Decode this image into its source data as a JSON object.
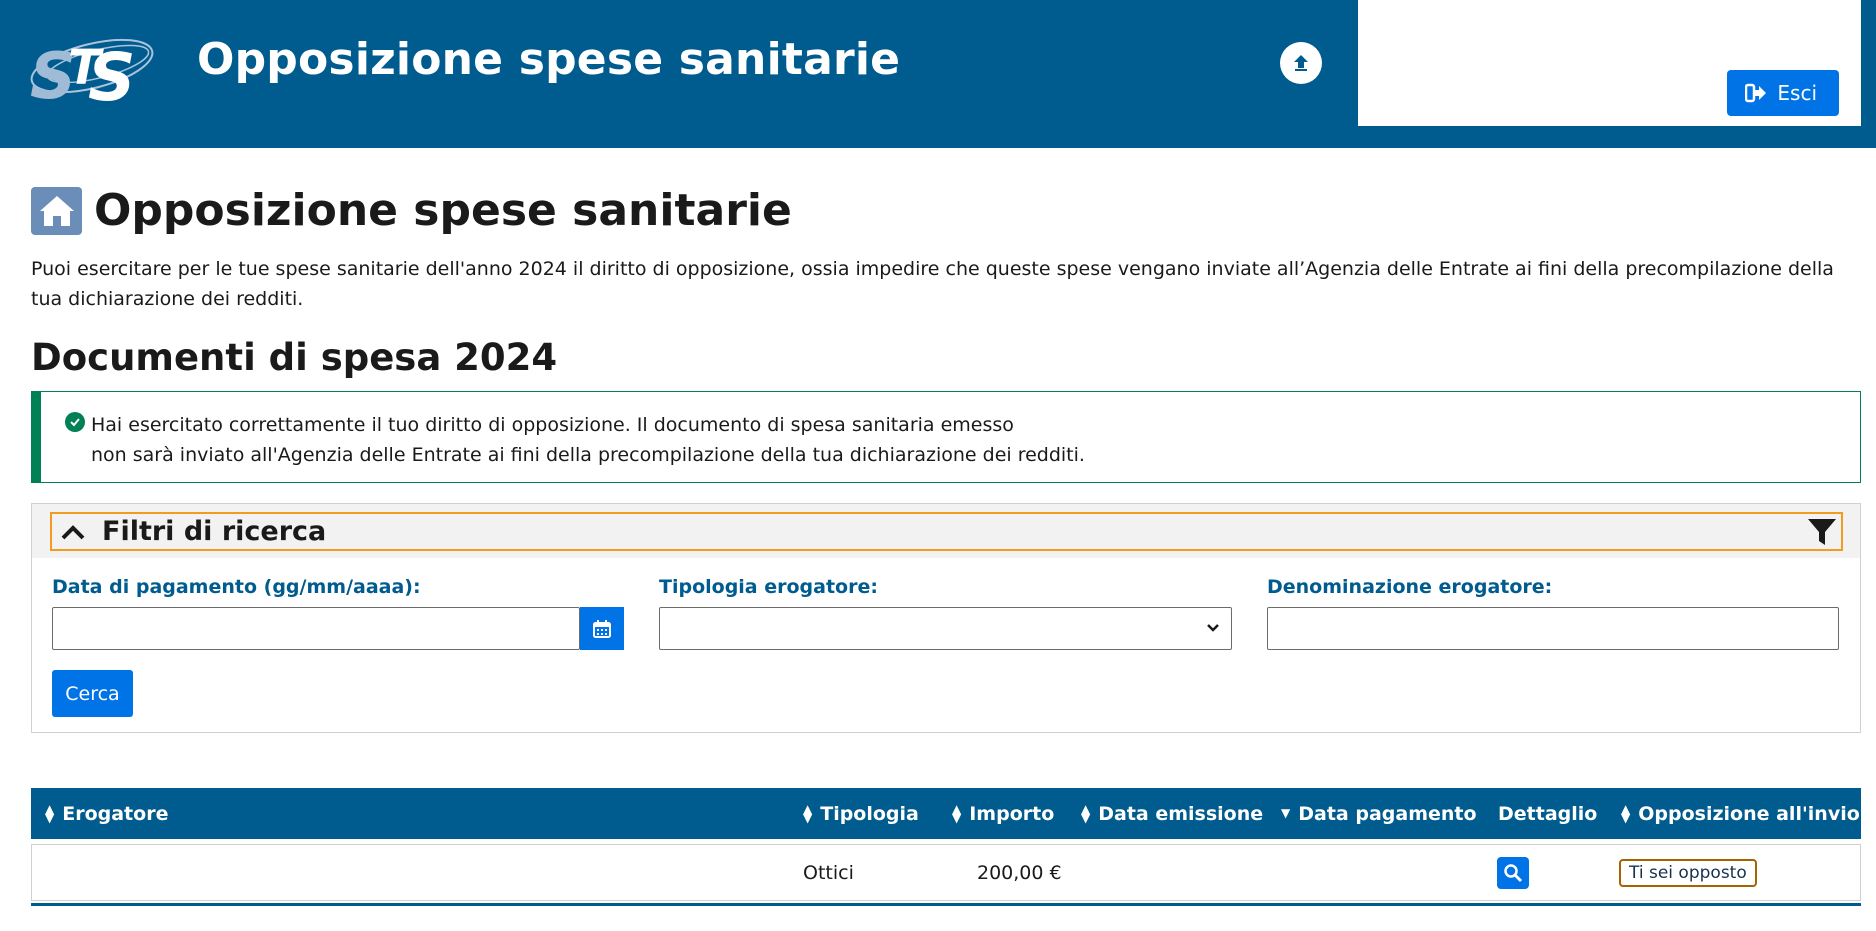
{
  "header": {
    "app_title": "Opposizione spese sanitarie",
    "logout_label": "Esci",
    "icons": {
      "logo": "sts-logo",
      "upload": "upload-icon",
      "logout": "sign-out-icon"
    }
  },
  "page": {
    "title": "Opposizione spese sanitarie",
    "intro": "Puoi esercitare per le tue spese sanitarie dell'anno 2024 il diritto di opposizione, ossia impedire che queste spese vengano inviate all’Agenzia delle Entrate ai fini della precompilazione della tua dichiarazione dei redditi.",
    "section_title": "Documenti di spesa 2024"
  },
  "alert": {
    "line1": "Hai esercitato correttamente il tuo diritto di opposizione. Il documento di spesa sanitaria emesso",
    "line2": "non sarà inviato all'Agenzia delle Entrate ai fini della precompilazione della tua dichiarazione dei redditi."
  },
  "filters": {
    "title": "Filtri di ricerca",
    "date_label": "Data di pagamento (gg/mm/aaaa):",
    "date_value": "",
    "type_label": "Tipologia erogatore:",
    "type_selected": "",
    "name_label": "Denominazione erogatore:",
    "name_value": "",
    "search_label": "Cerca"
  },
  "table": {
    "columns": [
      "Erogatore",
      "Tipologia",
      "Importo",
      "Data emissione",
      "Data pagamento",
      "Dettaglio",
      "Opposizione all'invio"
    ],
    "rows": [
      {
        "erogatore": "",
        "tipologia": "Ottici",
        "importo": "200,00 €",
        "data_emissione": "",
        "data_pagamento": "",
        "opposizione": "Ti sei opposto"
      }
    ]
  },
  "colors": {
    "brand": "#005b8f",
    "primary": "#0073e6",
    "success": "#008055",
    "focus": "#f29c1f"
  }
}
